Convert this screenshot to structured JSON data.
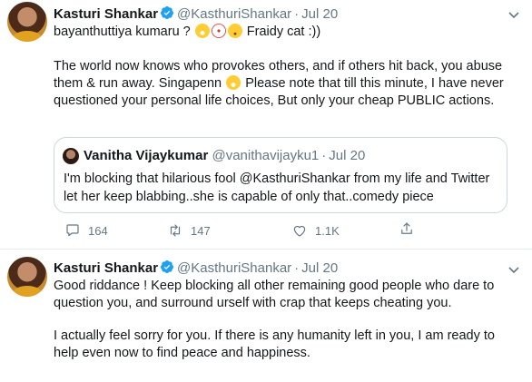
{
  "tweets": [
    {
      "name": "Kasturi Shankar",
      "handle": "@KasthuriShankar",
      "dot": "·",
      "date": "Jul 20",
      "line1_a": "bayanthuttiya kumaru ?",
      "line1_b": "Fraidy cat :))",
      "para_a": "The world now knows who provokes others, and  if others hit back, you abuse them & run away.  Singapenn",
      "para_b": "Please note that till this minute, I have never questioned your personal life choices, But only your cheap PUBLIC actions.",
      "emoji_icons": [
        "rolling-laughing-emoji",
        "clown-emoji",
        "smiling-emoji",
        "rolling-laughing-emoji"
      ],
      "quote": {
        "name": "Vanitha Vijaykumar",
        "handle": "@vanithavijayku1",
        "dot": "·",
        "date": "Jul 20",
        "text": "I'm blocking that hilarious fool @KasthuriShankar from my life and Twitter let her keep blabbing..she is capable of only that..comedy piece"
      },
      "actions": {
        "replies": "164",
        "retweets": "147",
        "likes": "1.1K"
      }
    },
    {
      "name": "Kasturi Shankar",
      "handle": "@KasthuriShankar",
      "dot": "·",
      "date": "Jul 20",
      "text": "Good riddance !  Keep blocking all other remaining good people  who dare to question you, and surround urself with  crap that keeps cheating you.",
      "text2": "I actually feel sorry for you. If there is any humanity left in you,  I am  ready to help even now to find peace and happiness."
    }
  ],
  "colors": {
    "verified": "#1da1f2",
    "secondary_text": "#657786",
    "border": "#e6ecf0"
  }
}
